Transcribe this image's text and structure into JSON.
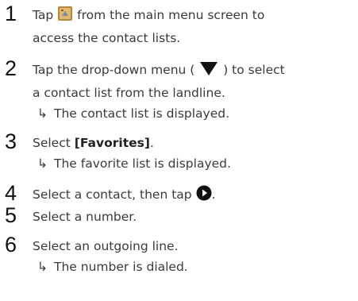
{
  "steps": [
    {
      "num": "1",
      "text_before": "Tap",
      "icon": "contacts-book-icon",
      "text_after": "from the main menu screen to",
      "line2": "access the contact lists."
    },
    {
      "num": "2",
      "text_before": "Tap the drop-down menu (",
      "icon": "triangle-down-icon",
      "text_after": ") to select",
      "line2": "a contact list from the landline.",
      "result": "The contact list is displayed."
    },
    {
      "num": "3",
      "text_before": "Select",
      "bold": "[Favorites]",
      "text_after": ".",
      "result": "The favorite list is displayed."
    },
    {
      "num": "4",
      "text_before": "Select a contact, then tap",
      "icon": "play-circle-icon",
      "text_after": "."
    },
    {
      "num": "5",
      "text": "Select a number."
    },
    {
      "num": "6",
      "text": "Select an outgoing line.",
      "result": "The number is dialed."
    }
  ],
  "arrow_glyph": "↳",
  "icon_colors": {
    "book": "#b8873a",
    "accent": "#111111"
  }
}
